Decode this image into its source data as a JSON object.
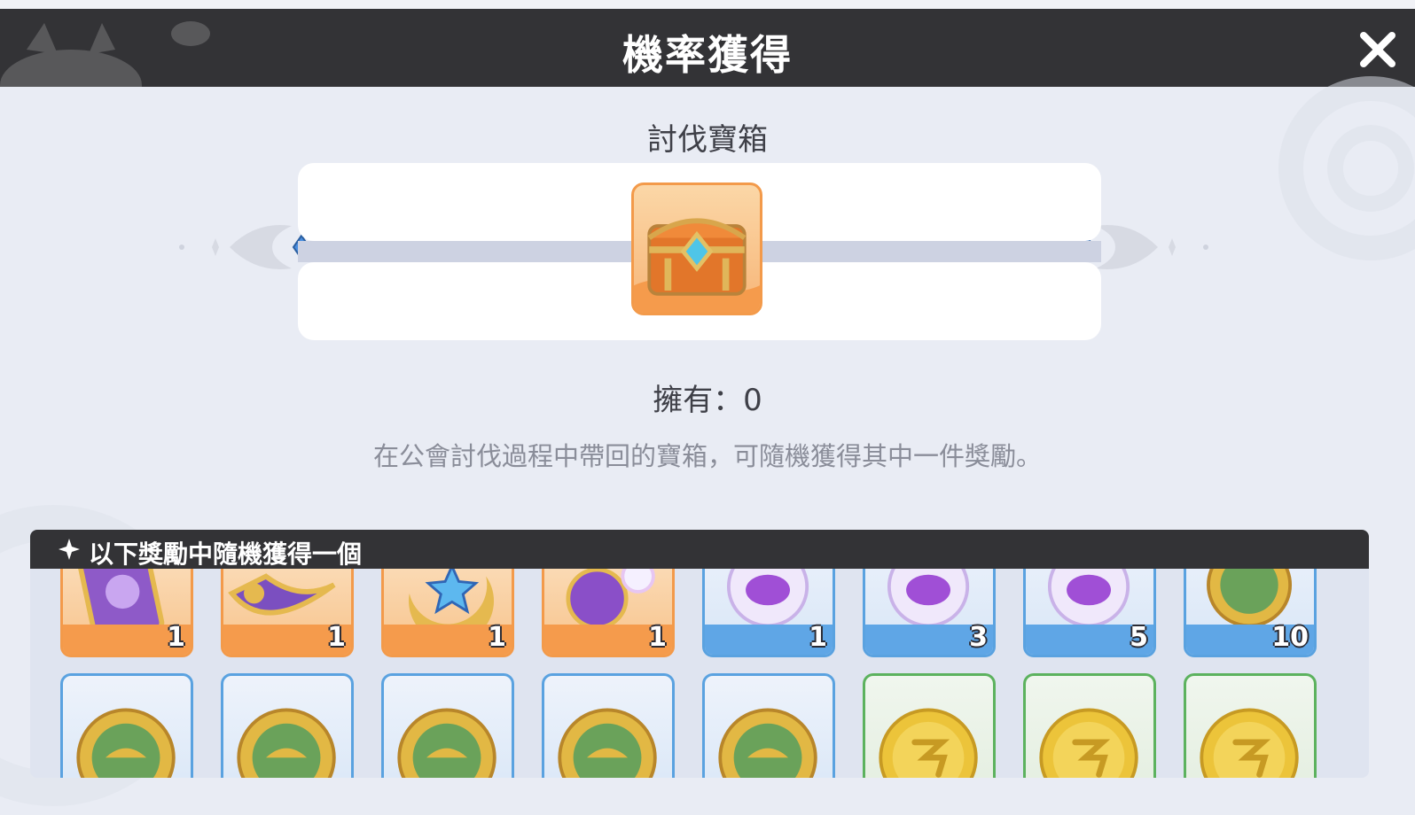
{
  "header": {
    "title": "機率獲得",
    "close_icon": "close-icon"
  },
  "chest": {
    "name": "討伐寶箱",
    "owned_label": "擁有：",
    "owned_count": "0",
    "description": "在公會討伐過程中帶回的寶箱，可隨機獲得其中一件獎勵。",
    "icon": "treasure-chest-icon"
  },
  "rewards": {
    "title": "以下獎勵中隨機獲得一個",
    "row1": [
      {
        "icon": "purple-card-icon",
        "qty": "1",
        "rarity": "orange"
      },
      {
        "icon": "crescent-horn-icon",
        "qty": "1",
        "rarity": "orange"
      },
      {
        "icon": "star-moon-icon",
        "qty": "1",
        "rarity": "orange"
      },
      {
        "icon": "purple-orb-icon",
        "qty": "1",
        "rarity": "orange"
      },
      {
        "icon": "purple-potion-icon",
        "qty": "1",
        "rarity": "blue"
      },
      {
        "icon": "purple-potion-icon",
        "qty": "3",
        "rarity": "blue"
      },
      {
        "icon": "purple-potion-icon",
        "qty": "5",
        "rarity": "blue"
      },
      {
        "icon": "guild-coin-icon",
        "qty": "10",
        "rarity": "blue"
      }
    ],
    "row2": [
      {
        "icon": "guild-coin-icon",
        "rarity": "blue"
      },
      {
        "icon": "guild-coin-icon",
        "rarity": "blue"
      },
      {
        "icon": "guild-coin-icon",
        "rarity": "blue"
      },
      {
        "icon": "guild-coin-icon",
        "rarity": "blue"
      },
      {
        "icon": "guild-coin-icon",
        "rarity": "blue"
      },
      {
        "icon": "gold-coin-icon",
        "rarity": "green"
      },
      {
        "icon": "gold-coin-icon",
        "rarity": "green"
      },
      {
        "icon": "gold-coin-icon",
        "rarity": "green"
      }
    ]
  }
}
